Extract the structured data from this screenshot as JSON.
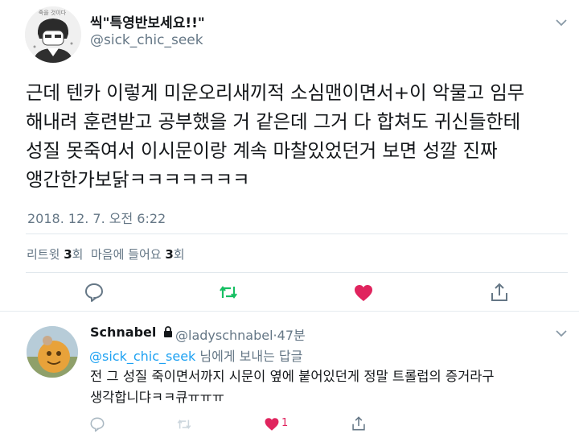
{
  "tweet": {
    "display_name": "씩\"특영반보세요!!\"",
    "handle": "@sick_chic_seek",
    "text": "근데 텐카 이렇게 미운오리새끼적 소심맨이면서+이 악물고 임무\n해내려 훈련받고 공부했을 거 같은데 그거 다 합쳐도 귀신들한테\n성질 못죽여서 이시문이랑 계속 마찰있었던거 보면 성깔 진짜\n앵간한가보닭ㅋㅋㅋㅋㅋㅋㅋ",
    "timestamp": "2018. 12. 7. 오전 6:22",
    "retweets_label": "리트윗",
    "retweets_count": "3",
    "likes_label": "마음에 들어요",
    "likes_count": "3",
    "count_unit": "회",
    "avatar_caption": "죽을 것이다"
  },
  "reply": {
    "display_name": "Schnabel",
    "handle": "@ladyschnabel",
    "time": "47분",
    "separator": "·",
    "mention": "@sick_chic_seek",
    "context_suffix": " 님에게 보내는 답글",
    "text": "전 그 성질 죽이면서까지 시문이 옆에 붙어있던게 정말 트롤럽의 증거라구\n생각합니댜ㅋㅋ큐ㅠㅠㅠ",
    "like_count": "1"
  },
  "colors": {
    "accent_blue": "#1da1f2",
    "retweet_green": "#17bf63",
    "like_red": "#e0245e",
    "secondary_text": "#657786"
  },
  "icons": [
    "chevron-down-icon",
    "reply-icon",
    "retweet-icon",
    "heart-icon",
    "share-icon",
    "lock-icon"
  ]
}
